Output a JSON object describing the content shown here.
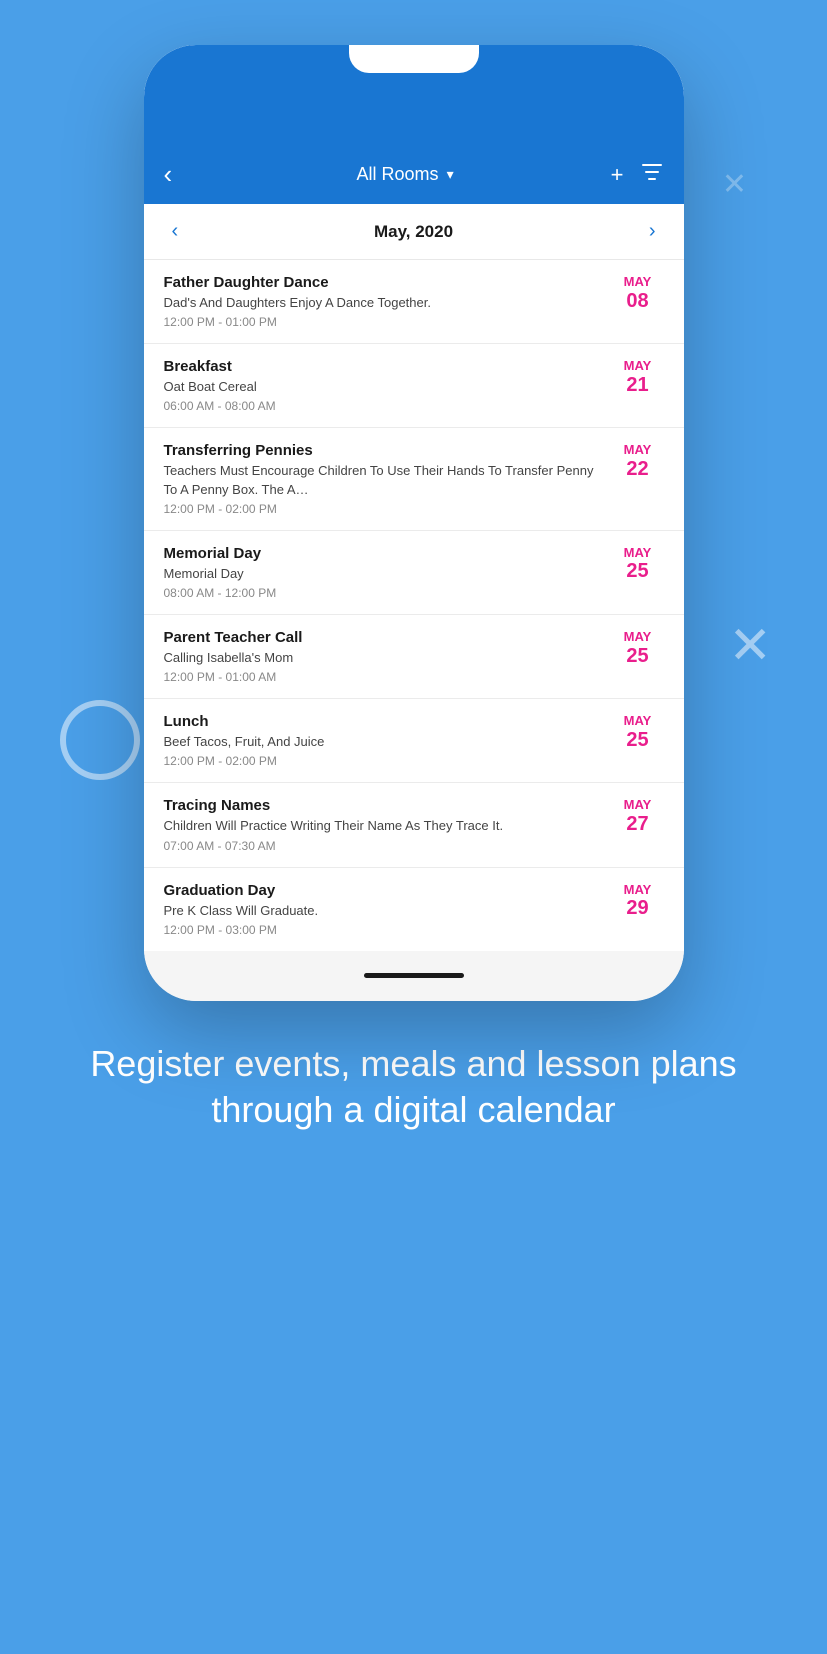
{
  "background_color": "#4A9FE8",
  "header": {
    "back_label": "‹",
    "title": "All Rooms",
    "chevron": "∨",
    "add_icon": "+",
    "filter_icon": "⊿"
  },
  "month_nav": {
    "prev_arrow": "‹",
    "next_arrow": "›",
    "title": "May, 2020"
  },
  "events": [
    {
      "title": "Father Daughter Dance",
      "description": "Dad's And Daughters Enjoy A Dance Together.",
      "time": "12:00 PM - 01:00 PM",
      "date_month": "MAY",
      "date_day": "08"
    },
    {
      "title": "Breakfast",
      "description": "Oat Boat Cereal",
      "time": "06:00 AM - 08:00 AM",
      "date_month": "MAY",
      "date_day": "21"
    },
    {
      "title": "Transferring Pennies",
      "description": "Teachers Must Encourage Children To Use Their Hands To Transfer Penny To A Penny Box. The A…",
      "time": "12:00 PM - 02:00 PM",
      "date_month": "MAY",
      "date_day": "22"
    },
    {
      "title": "Memorial Day",
      "description": "Memorial Day",
      "time": "08:00 AM - 12:00 PM",
      "date_month": "MAY",
      "date_day": "25"
    },
    {
      "title": "Parent Teacher Call",
      "description": "Calling Isabella's Mom",
      "time": "12:00 PM - 01:00 AM",
      "date_month": "MAY",
      "date_day": "25"
    },
    {
      "title": "Lunch",
      "description": "Beef Tacos, Fruit, And Juice",
      "time": "12:00 PM - 02:00 PM",
      "date_month": "MAY",
      "date_day": "25"
    },
    {
      "title": "Tracing Names",
      "description": "Children Will Practice Writing Their Name As They Trace It.",
      "time": "07:00 AM - 07:30 AM",
      "date_month": "MAY",
      "date_day": "27"
    },
    {
      "title": "Graduation Day",
      "description": "Pre K Class Will Graduate.",
      "time": "12:00 PM - 03:00 PM",
      "date_month": "MAY",
      "date_day": "29"
    }
  ],
  "bottom_text": "Register events, meals and lesson plans through a digital calendar"
}
